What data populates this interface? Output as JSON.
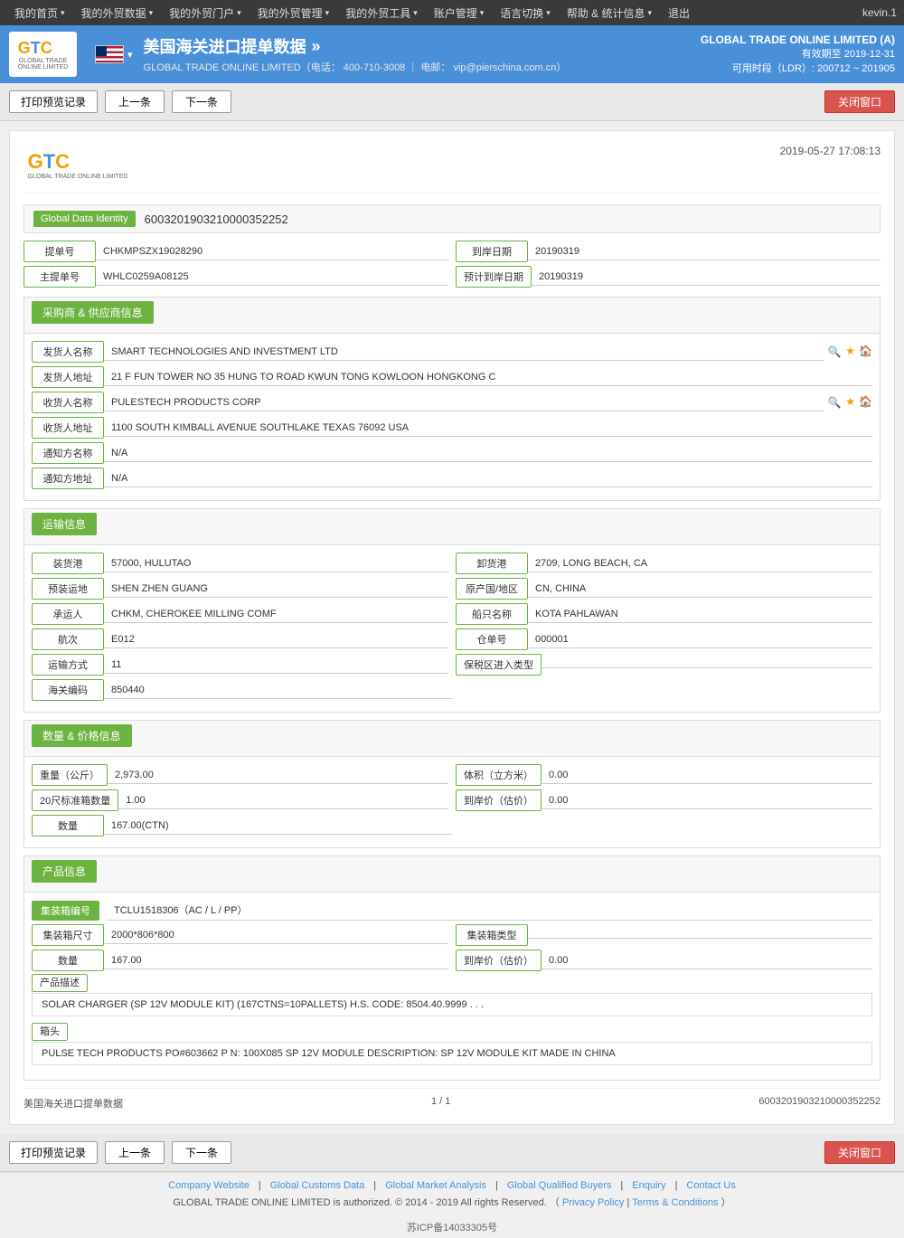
{
  "topNav": {
    "items": [
      "我的首页",
      "我的外贸数据",
      "我的外贸门户",
      "我的外贸管理",
      "我的外贸工具",
      "账户管理",
      "语言切换",
      "帮助 & 统计信息",
      "退出"
    ],
    "userLabel": "kevin.1"
  },
  "header": {
    "logo": "GTC",
    "logoSub": "GLOBAL TRADE ONLINE LIMITED",
    "title": "美国海关进口提单数据",
    "titleSuffix": "»",
    "subtitle": "GLOBAL TRADE ONLINE LIMITED（电话： 400-710-3008 ｜ 电邮： vip@pierschina.com.cn）",
    "flagAlt": "US Flag",
    "companyName": "GLOBAL TRADE ONLINE LIMITED (A)",
    "validUntil": "有效期至 2019-12-31",
    "ldrInfo": "可用时段（LDR）: 200712 ~ 201905"
  },
  "actionBar": {
    "printLabel": "打印预览记录",
    "prevLabel": "上一条",
    "nextLabel": "下一条",
    "closeLabel": "关闭窗口"
  },
  "document": {
    "logoText": "GTC",
    "logoSub": "GLOBAL TRADE ONLINE LIMITED",
    "datetime": "2019-05-27 17:08:13",
    "globalDataIdentityLabel": "Global Data Identity",
    "globalDataIdentityValue": "6003201903210000352252",
    "fields": {
      "billNo": {
        "label": "提单号",
        "value": "CHKMPSZX19028290"
      },
      "arrivalDate": {
        "label": "到岸日期",
        "value": "20190319"
      },
      "mainBillNo": {
        "label": "主提单号",
        "value": "WHLC0259A08125"
      },
      "estimatedDate": {
        "label": "预计到岸日期",
        "value": "20190319"
      }
    },
    "buyerSupplier": {
      "sectionLabel": "采购商 & 供应商信息",
      "shipperName": {
        "label": "发货人名称",
        "value": "SMART TECHNOLOGIES AND INVESTMENT LTD"
      },
      "shipperAddr": {
        "label": "发货人地址",
        "value": "21 F FUN TOWER NO 35 HUNG TO ROAD KWUN TONG KOWLOON HONGKONG C"
      },
      "consigneeName": {
        "label": "收货人名称",
        "value": "PULESTECH PRODUCTS CORP"
      },
      "consigneeAddr": {
        "label": "收货人地址",
        "value": "1100 SOUTH KIMBALL AVENUE SOUTHLAKE TEXAS 76092 USA"
      },
      "notifyName": {
        "label": "通知方名称",
        "value": "N/A"
      },
      "notifyAddr": {
        "label": "通知方地址",
        "value": "N/A"
      }
    },
    "transport": {
      "sectionLabel": "运输信息",
      "loadPort": {
        "label": "装货港",
        "value": "57000, HULUTAO"
      },
      "dischargePort": {
        "label": "卸货港",
        "value": "2709, LONG BEACH, CA"
      },
      "preCarriage": {
        "label": "预装运地",
        "value": "SHEN ZHEN GUANG"
      },
      "originCountry": {
        "label": "原产国/地区",
        "value": "CN, CHINA"
      },
      "carrier": {
        "label": "承运人",
        "value": "CHKM, CHEROKEE MILLING COMF"
      },
      "vesselName": {
        "label": "船只名称",
        "value": "KOTA PAHLAWAN"
      },
      "voyage": {
        "label": "航次",
        "value": "E012"
      },
      "billOfLading": {
        "label": "仓单号",
        "value": "000001"
      },
      "transportMode": {
        "label": "运输方式",
        "value": "11"
      },
      "ftzEntry": {
        "label": "保税区进入类型",
        "value": ""
      },
      "customsCode": {
        "label": "海关编码",
        "value": "850440"
      }
    },
    "quantityPrice": {
      "sectionLabel": "数量 & 价格信息",
      "weight": {
        "label": "重量（公斤）",
        "value": "2,973.00"
      },
      "volume": {
        "label": "体积（立方米）",
        "value": "0.00"
      },
      "container20": {
        "label": "20尺标准箱数量",
        "value": "1.00"
      },
      "landedPrice": {
        "label": "到岸价（估价）",
        "value": "0.00"
      },
      "quantity": {
        "label": "数量",
        "value": "167.00(CTN)"
      }
    },
    "product": {
      "sectionLabel": "产品信息",
      "containerNo": {
        "label": "集装箱编号",
        "value": "TCLU1518306（AC / L / PP）"
      },
      "containerSize": {
        "label": "集装箱尺寸",
        "value": "2000*806*800"
      },
      "containerType": {
        "label": "集装箱类型",
        "value": ""
      },
      "quantity": {
        "label": "数量",
        "value": "167.00"
      },
      "landedPrice": {
        "label": "到岸价（估价）",
        "value": "0.00"
      },
      "descriptionLabel": "产品描述",
      "descriptionValue": "SOLAR CHARGER (SP 12V MODULE KIT) (167CTNS=10PALLETS) H.S. CODE: 8504.40.9999 . . .",
      "headLabel": "箱头",
      "headValue": "PULSE TECH PRODUCTS PO#603662 P N: 100X085 SP 12V MODULE DESCRIPTION: SP 12V MODULE KIT MADE IN CHINA"
    },
    "footerLeft": "美国海关进口提单数据",
    "footerPage": "1 / 1",
    "footerRight": "6003201903210000352252"
  },
  "bottomActionBar": {
    "printLabel": "打印预览记录",
    "prevLabel": "上一条",
    "nextLabel": "下一条",
    "closeLabel": "关闭窗口"
  },
  "pageFooter": {
    "links": [
      "Company Website",
      "Global Customs Data",
      "Global Market Analysis",
      "Global Qualified Buyers",
      "Enquiry",
      "Contact Us"
    ],
    "copyright": "GLOBAL TRADE ONLINE LIMITED is authorized. © 2014 - 2019 All rights Reserved.",
    "privacyLabel": "Privacy Policy",
    "termsLabel": "Terms & Conditions"
  },
  "icp": {
    "label": "苏ICP备14033305号"
  }
}
